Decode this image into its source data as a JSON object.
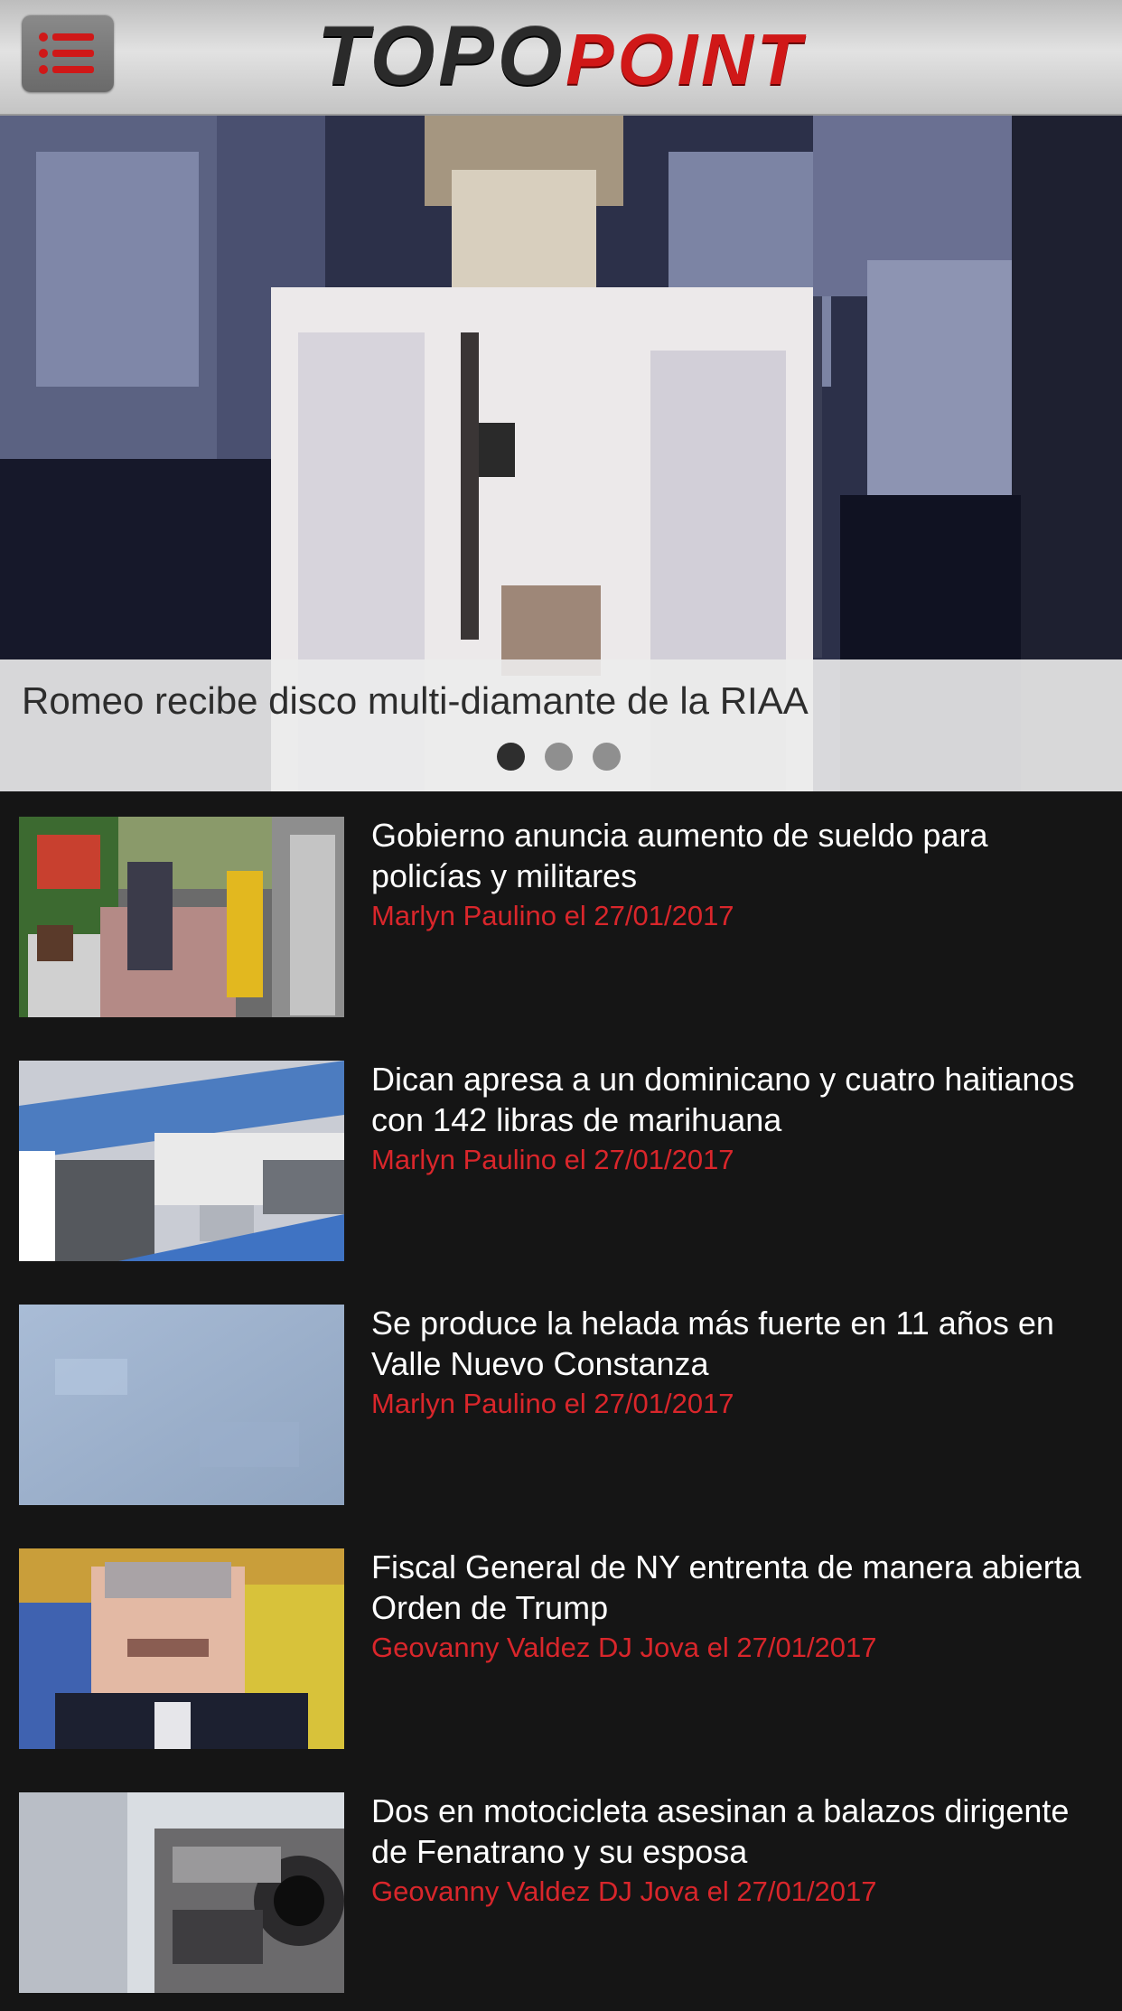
{
  "header": {
    "logo_dark": "TOPO",
    "logo_red": "POINT"
  },
  "hero": {
    "title": "Romeo recibe disco multi-diamante de la RIAA",
    "slide_count": 3,
    "active_slide": 1
  },
  "news": [
    {
      "title": "Gobierno anuncia aumento de sueldo para policías y militares",
      "meta": "Marlyn Paulino el 27/01/2017"
    },
    {
      "title": "Dican apresa a un dominicano y cuatro haitianos con 142 libras de marihuana",
      "meta": "Marlyn Paulino el 27/01/2017"
    },
    {
      "title": "Se produce la helada más fuerte en 11 años en Valle Nuevo Constanza",
      "meta": "Marlyn Paulino el 27/01/2017"
    },
    {
      "title": "Fiscal General de NY entrenta de manera abierta Orden de Trump",
      "meta": "Geovanny Valdez DJ Jova el 27/01/2017"
    },
    {
      "title": "Dos en motocicleta asesinan a balazos dirigente de Fenatrano y su esposa",
      "meta": "Geovanny Valdez DJ Jova el 27/01/2017"
    }
  ],
  "colors": {
    "accent": "#d9262b",
    "background": "#151515"
  },
  "icons": {
    "menu": "hamburger-menu-icon"
  }
}
